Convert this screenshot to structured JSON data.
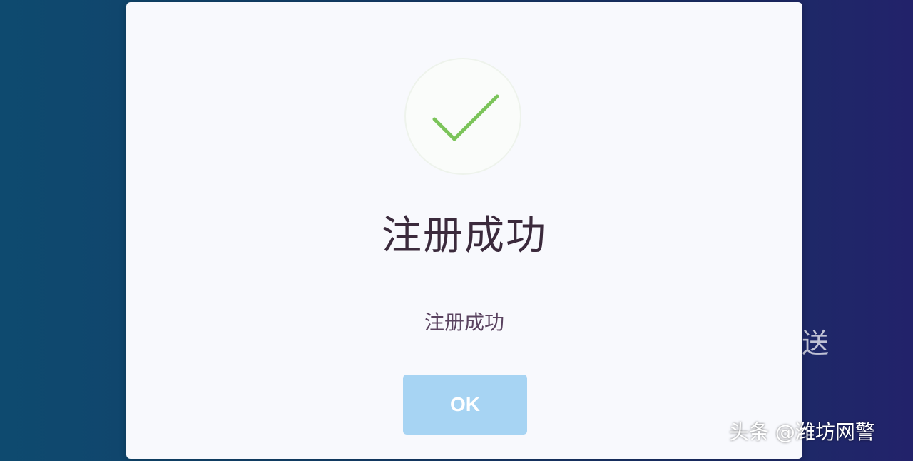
{
  "background": {
    "partial_text": "送"
  },
  "dialog": {
    "icon": "checkmark-icon",
    "icon_color": "#7bc45a",
    "title": "注册成功",
    "message": "注册成功",
    "ok_label": "OK",
    "ok_color": "#a7d4f3"
  },
  "watermark": {
    "text": "头条 @潍坊网警"
  }
}
